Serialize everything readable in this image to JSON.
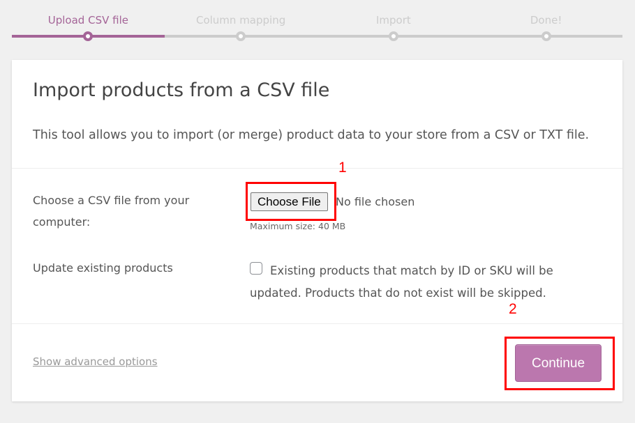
{
  "steps": [
    {
      "label": "Upload CSV file",
      "active": true
    },
    {
      "label": "Column mapping",
      "active": false
    },
    {
      "label": "Import",
      "active": false
    },
    {
      "label": "Done!",
      "active": false
    }
  ],
  "card": {
    "title": "Import products from a CSV file",
    "description": "This tool allows you to import (or merge) product data to your store from a CSV or TXT file.",
    "file_row": {
      "label": "Choose a CSV file from your computer:",
      "button_label": "Choose File",
      "status": "No file chosen",
      "max_size": "Maximum size: 40 MB"
    },
    "update_row": {
      "label": "Update existing products",
      "checked": false,
      "checkbox_text": "Existing products that match by ID or SKU will be updated. Products that do not exist will be skipped."
    },
    "advanced_link": "Show advanced options",
    "continue_label": "Continue"
  },
  "annotations": [
    {
      "number": "1",
      "target": "choose-file-button"
    },
    {
      "number": "2",
      "target": "continue-button"
    }
  ],
  "colors": {
    "accent": "#a46497",
    "button": "#bb77ae",
    "inactive": "#cccccc",
    "annotation": "#ff0000"
  }
}
